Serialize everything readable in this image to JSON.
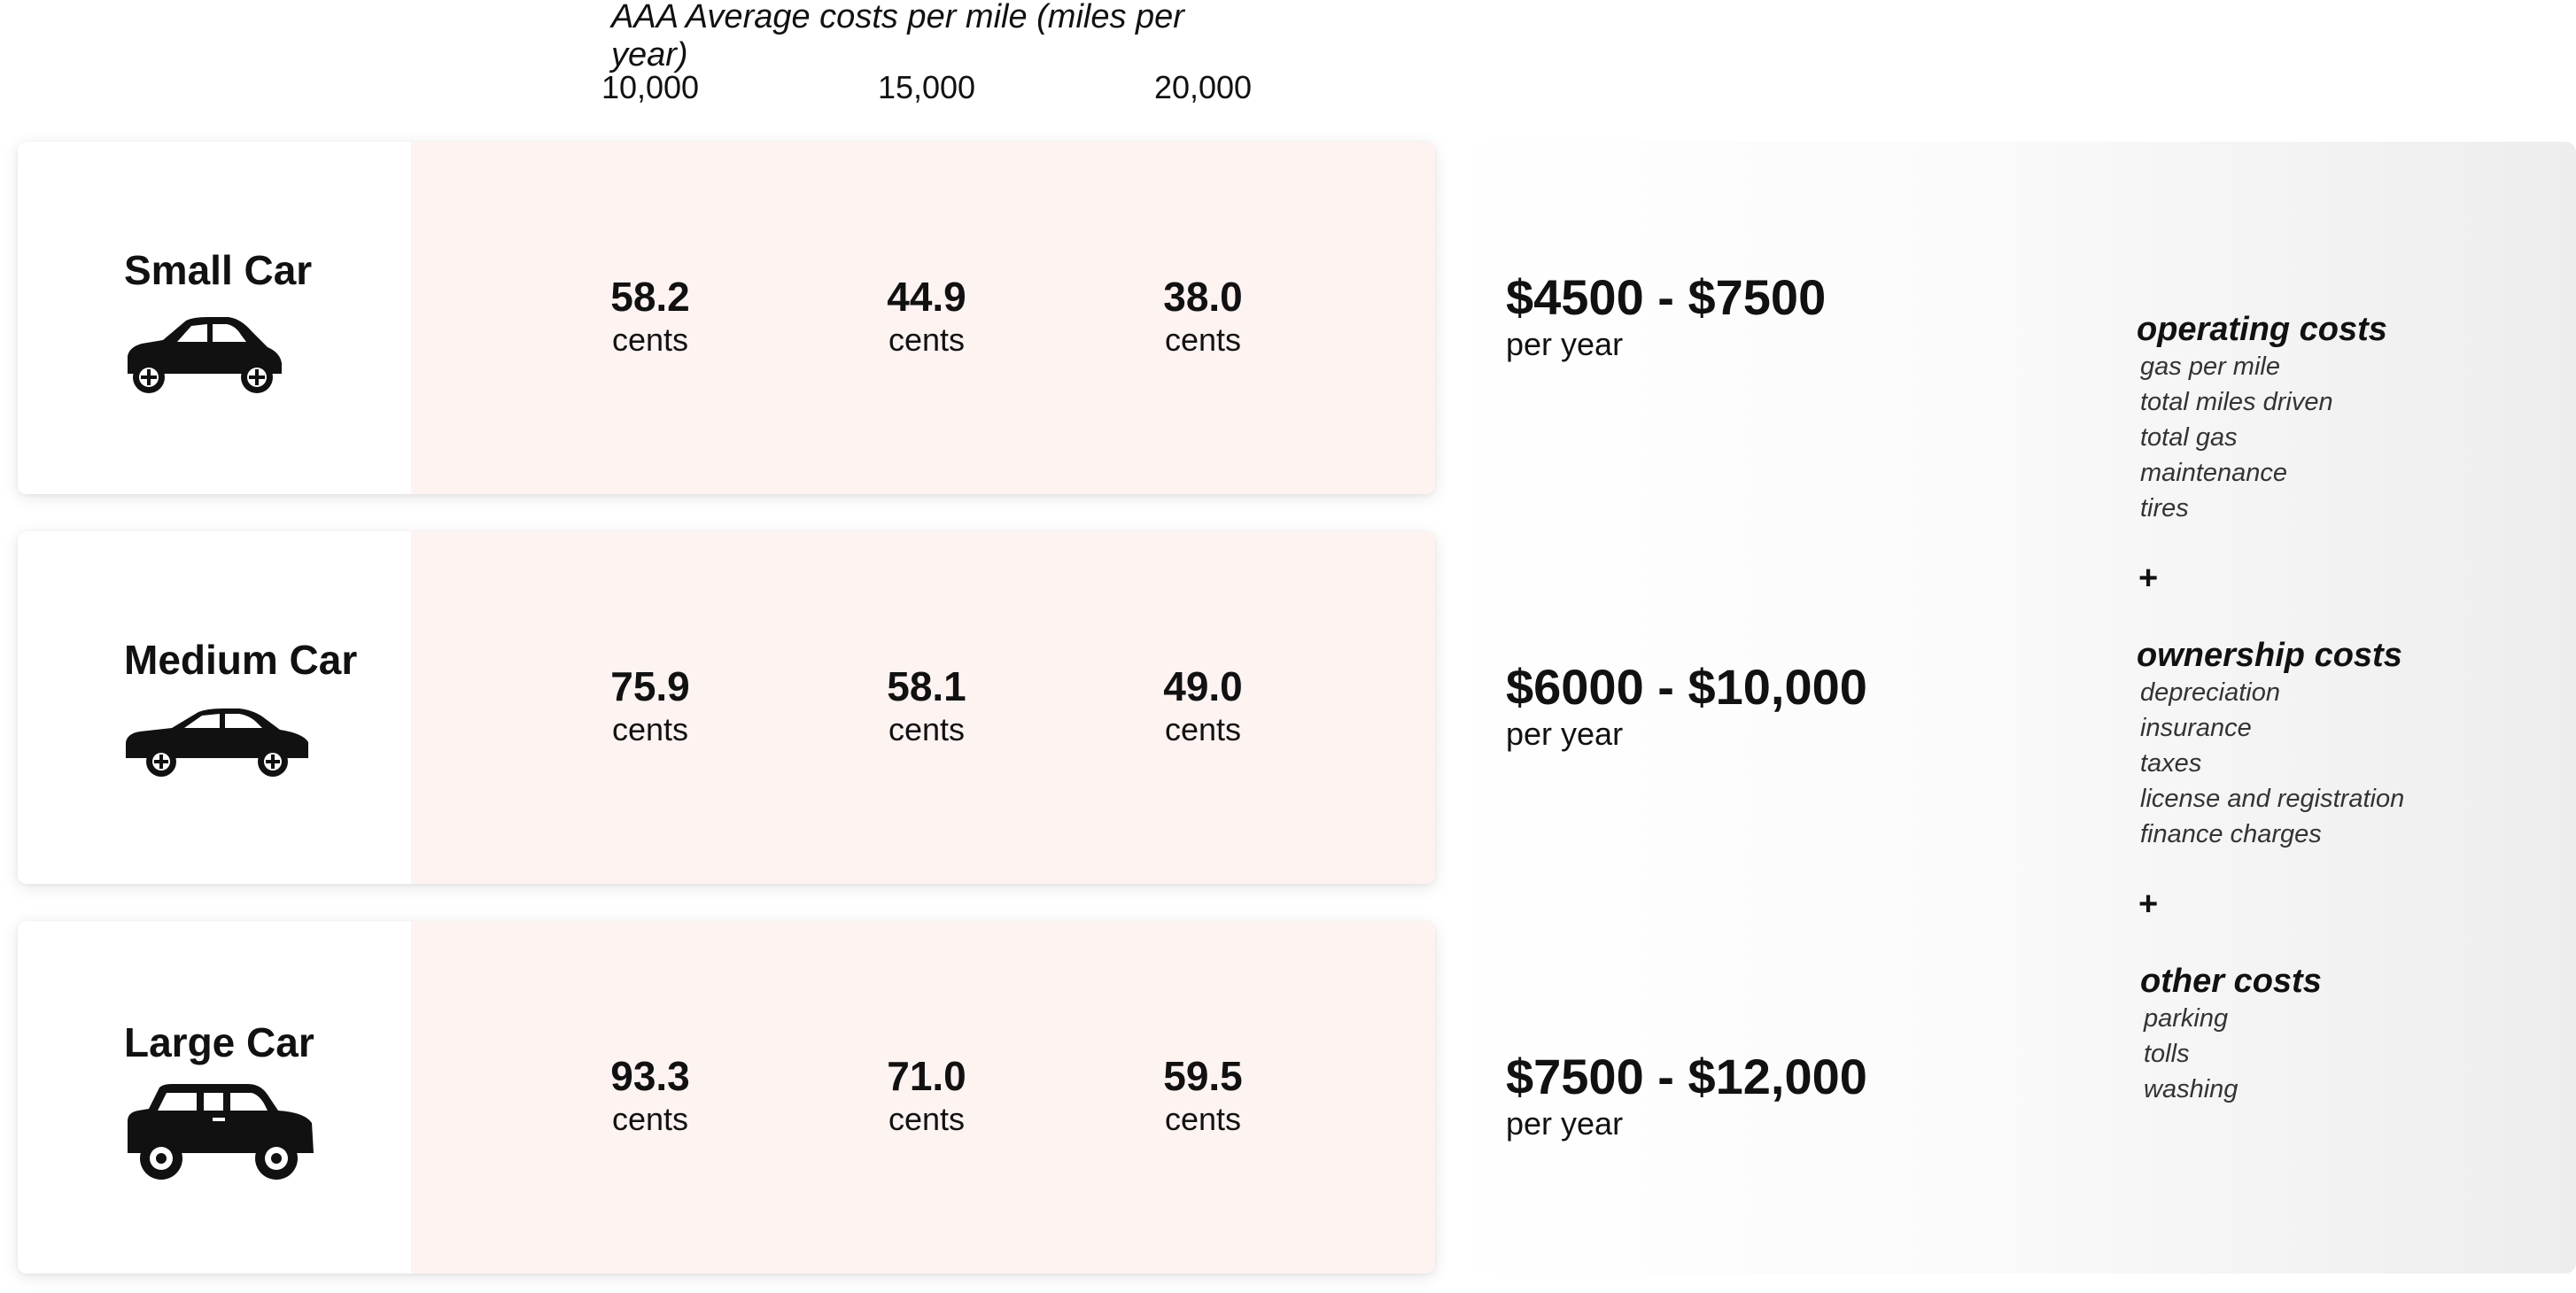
{
  "header": {
    "title": "AAA Average costs per mile (miles per year)",
    "columns": [
      "10,000",
      "15,000",
      "20,000"
    ]
  },
  "rows": [
    {
      "name": "Small Car",
      "icon": "small-car-icon",
      "values": [
        {
          "num": "58.2",
          "unit": "cents"
        },
        {
          "num": "44.9",
          "unit": "cents"
        },
        {
          "num": "38.0",
          "unit": "cents"
        }
      ],
      "range": "$4500 - $7500",
      "per": "per year"
    },
    {
      "name": "Medium Car",
      "icon": "sedan-car-icon",
      "values": [
        {
          "num": "75.9",
          "unit": "cents"
        },
        {
          "num": "58.1",
          "unit": "cents"
        },
        {
          "num": "49.0",
          "unit": "cents"
        }
      ],
      "range": "$6000 - $10,000",
      "per": "per year"
    },
    {
      "name": "Large Car",
      "icon": "suv-car-icon",
      "values": [
        {
          "num": "93.3",
          "unit": "cents"
        },
        {
          "num": "71.0",
          "unit": "cents"
        },
        {
          "num": "59.5",
          "unit": "cents"
        }
      ],
      "range": "$7500 - $12,000",
      "per": "per year"
    }
  ],
  "costs": {
    "plus": "+",
    "groups": [
      {
        "title": "operating costs",
        "items": [
          "gas per mile",
          "total miles driven",
          "total gas",
          "maintenance",
          "tires"
        ]
      },
      {
        "title": "ownership costs",
        "items": [
          "depreciation",
          "insurance",
          "taxes",
          "license and registration",
          "finance charges"
        ]
      },
      {
        "title": "other costs",
        "items": [
          "parking",
          "tolls",
          "washing"
        ]
      }
    ]
  },
  "colors": {
    "values_background": "#fdf3f1",
    "text": "#111111"
  }
}
